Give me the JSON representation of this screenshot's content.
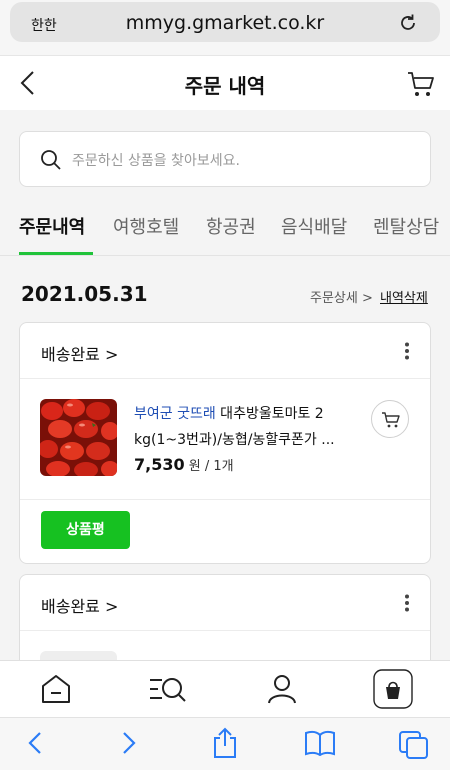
{
  "browser": {
    "aa_label": "한한",
    "url": "mmyg.gmarket.co.kr"
  },
  "header": {
    "title": "주문 내역"
  },
  "search": {
    "placeholder": "주문하신 상품을 찾아보세요."
  },
  "tabs": [
    {
      "label": "주문내역",
      "active": true
    },
    {
      "label": "여행호텔",
      "active": false
    },
    {
      "label": "항공권",
      "active": false
    },
    {
      "label": "음식배달",
      "active": false
    },
    {
      "label": "렌탈상담",
      "active": false
    }
  ],
  "order": {
    "date": "2021.05.31",
    "detail_link": "주문상세 >",
    "delete_link": "내역삭제"
  },
  "cards": [
    {
      "status": "배송완료 >",
      "seller": "부여군 굿뜨래",
      "product_line1": " 대추방울토마토 2",
      "product_line2": "kg(1~3번과)/농협/농할쿠폰가 ...",
      "price": "7,530",
      "price_unit": " 원 / 1개",
      "review_button": "상품평"
    },
    {
      "status": "배송완료 >"
    }
  ],
  "colors": {
    "accent_green": "#16c121",
    "seller_blue": "#1f4eb4"
  }
}
